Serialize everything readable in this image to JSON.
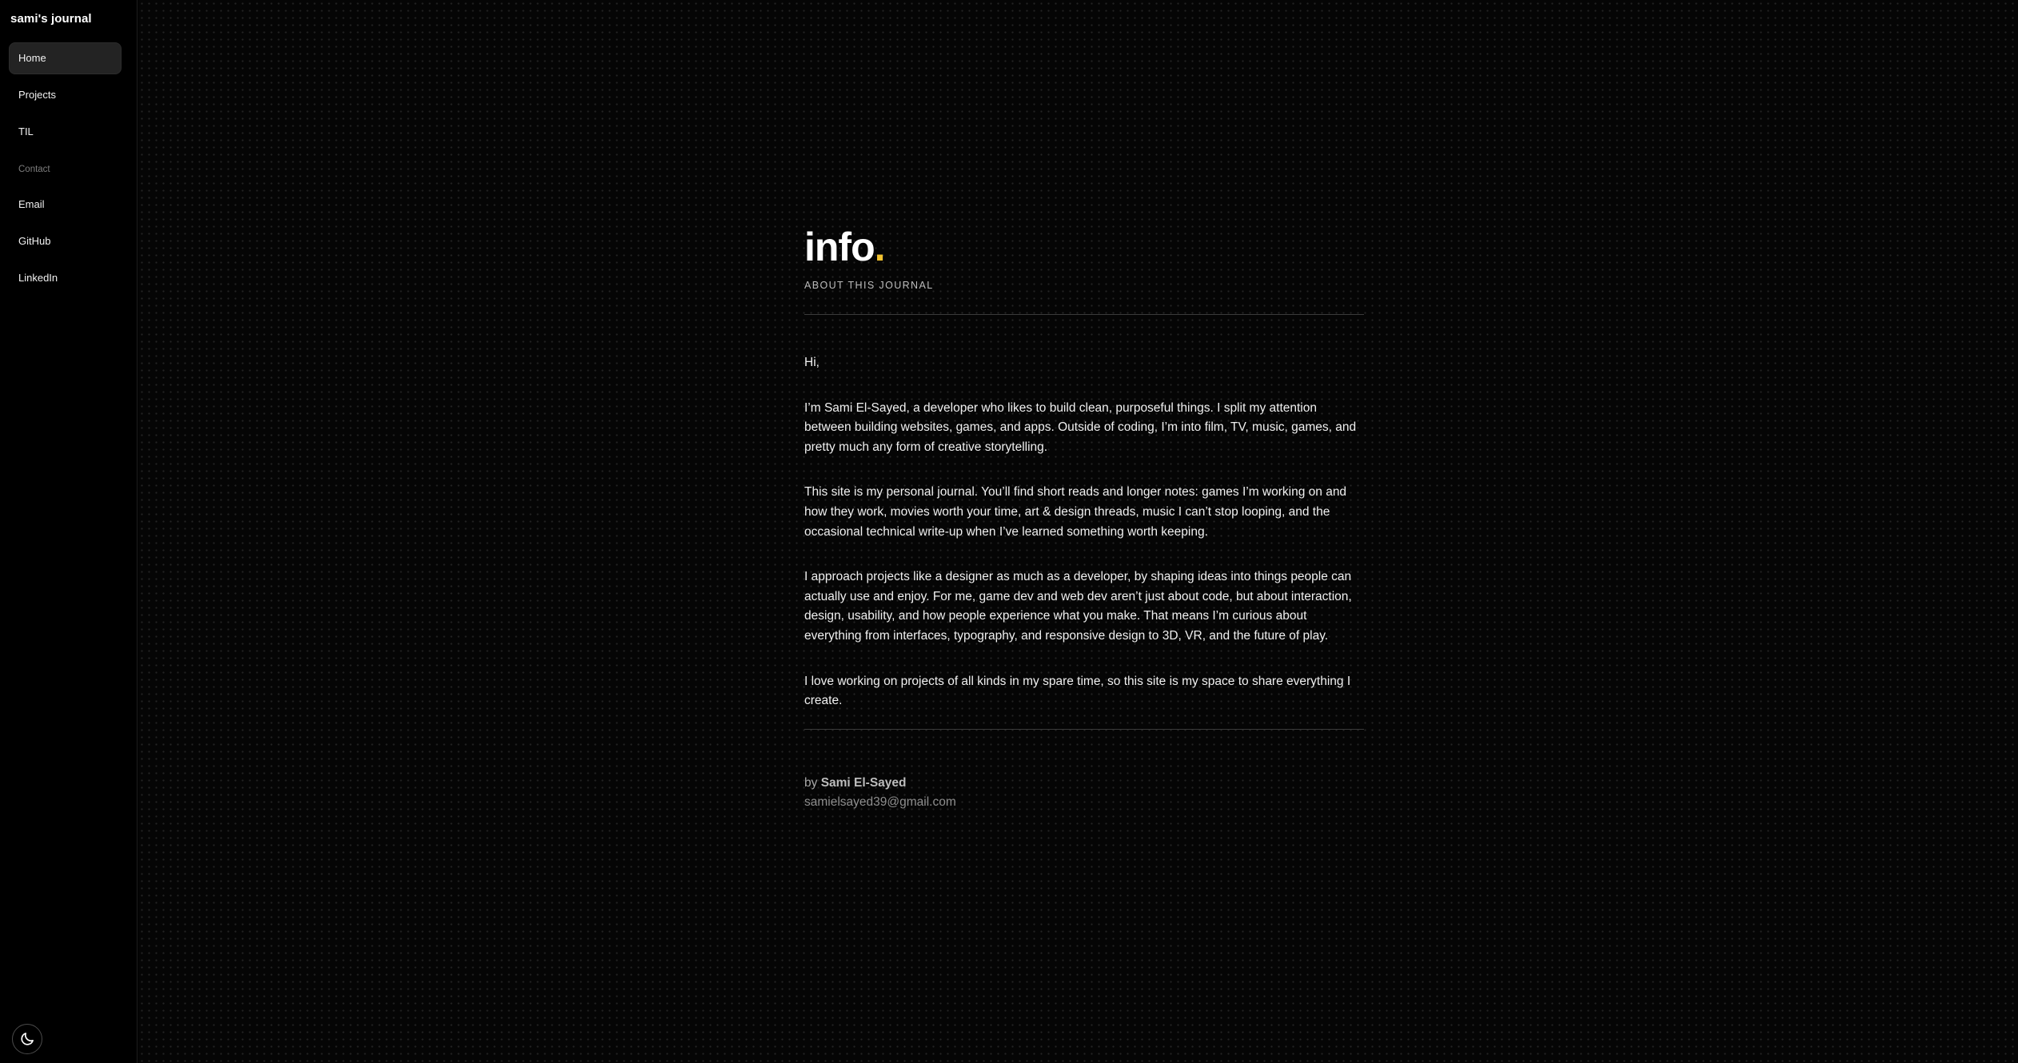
{
  "sidebar": {
    "brand": "sami's journal",
    "nav": [
      {
        "label": "Home",
        "active": true
      },
      {
        "label": "Projects",
        "active": false
      },
      {
        "label": "TIL",
        "active": false
      }
    ],
    "contact_section_label": "Contact",
    "contact": [
      {
        "label": "Email"
      },
      {
        "label": "GitHub"
      },
      {
        "label": "LinkedIn"
      }
    ],
    "theme_toggle_icon": "moon-icon"
  },
  "page": {
    "title": "info",
    "title_dot": ".",
    "subtitle": "ABOUT THIS JOURNAL",
    "paragraphs": [
      "Hi,",
      "I’m Sami El-Sayed, a developer who likes to build clean, purposeful things. I split my attention between building websites, games, and apps. Outside of coding, I’m into film, TV, music, games, and pretty much any form of creative storytelling.",
      "This site is my personal journal. You’ll find short reads and longer notes: games I’m working on and how they work, movies worth your time, art & design threads, music I can’t stop looping, and the occasional technical write-up when I’ve learned something worth keeping.",
      "I approach projects like a designer as much as a developer, by shaping ideas into things people can actually use and enjoy. For me, game dev and web dev aren’t just about code, but about interaction, design, usability, and how people experience what you make. That means I’m curious about everything from interfaces, typography, and responsive design to 3D, VR, and the future of play.",
      "I love working on projects of all kinds in my spare time, so this site is my space to share everything I create."
    ],
    "byline_prefix": "by",
    "author": "Sami El-Sayed",
    "email": "samielsayed39@gmail.com"
  },
  "colors": {
    "accent": "#f2c230",
    "background": "#000000"
  }
}
